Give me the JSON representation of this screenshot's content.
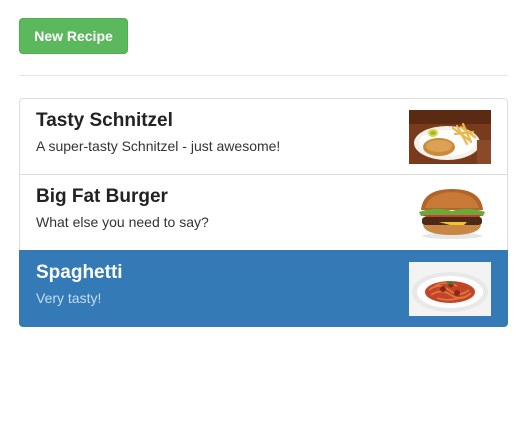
{
  "toolbar": {
    "new_recipe_label": "New Recipe"
  },
  "recipes": [
    {
      "name": "Tasty Schnitzel",
      "description": "A super-tasty Schnitzel - just awesome!",
      "image": "schnitzel-image",
      "selected": false
    },
    {
      "name": "Big Fat Burger",
      "description": "What else you need to say?",
      "image": "burger-image",
      "selected": false
    },
    {
      "name": "Spaghetti",
      "description": "Very tasty!",
      "image": "spaghetti-image",
      "selected": true
    }
  ],
  "colors": {
    "success_button": "#5cb85c",
    "active_item": "#337ab7"
  }
}
